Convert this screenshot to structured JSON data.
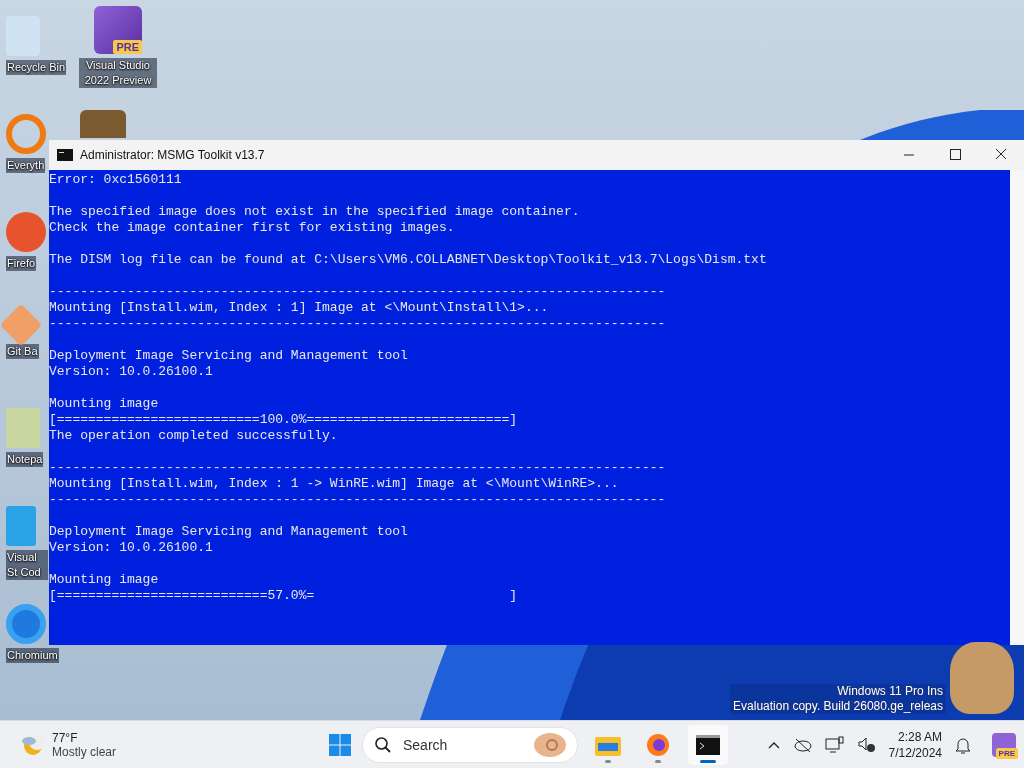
{
  "desktop_icons": [
    {
      "label": "Recycle Bin"
    },
    {
      "label": "Everyth"
    },
    {
      "label": "Firefo"
    },
    {
      "label": "Git Ba"
    },
    {
      "label": "Notepa"
    },
    {
      "label": "Visual St Cod"
    },
    {
      "label": "Chromium"
    }
  ],
  "desktop_icons_column_2": [
    {
      "label": "Visual Studio 2022 Preview",
      "badge": "PRE"
    }
  ],
  "window": {
    "title": "Administrator:  MSMG Toolkit v13.7",
    "paragraphs": [
      [
        "Error: 0xc1560111"
      ],
      [
        "The specified image does not exist in the specified image container.",
        "Check the image container first for existing images."
      ],
      [
        "The DISM log file can be found at C:\\Users\\VM6.COLLABNET\\Desktop\\Toolkit_v13.7\\Logs\\Dism.txt"
      ],
      [
        "-------------------------------------------------------------------------------",
        "Mounting [Install.wim, Index : 1] Image at <\\Mount\\Install\\1>...",
        "-------------------------------------------------------------------------------"
      ],
      [
        "Deployment Image Servicing and Management tool",
        "Version: 10.0.26100.1"
      ],
      [
        "Mounting image",
        "[==========================100.0%==========================]",
        "The operation completed successfully."
      ],
      [
        "-------------------------------------------------------------------------------",
        "Mounting [Install.wim, Index : 1 -> WinRE.wim] Image at <\\Mount\\WinRE>...",
        "-------------------------------------------------------------------------------"
      ],
      [
        "Deployment Image Servicing and Management tool",
        "Version: 10.0.26100.1"
      ],
      [
        "Mounting image",
        "[===========================57.0%=                         ]"
      ]
    ]
  },
  "watermark": [
    "Windows 11 Pro Ins",
    "Evaluation copy. Build 26080.ge_releas"
  ],
  "taskbar": {
    "weather": {
      "temperature": "77°F",
      "condition": "Mostly clear"
    },
    "search": {
      "placeholder": "Search"
    },
    "apps": [
      {
        "kind": "folder",
        "active": false
      },
      {
        "kind": "browser",
        "active": false
      },
      {
        "kind": "terminal",
        "active": true
      }
    ],
    "clock": {
      "time": "2:28 AM",
      "date": "7/12/2024"
    },
    "tray_badge": "PRE"
  }
}
